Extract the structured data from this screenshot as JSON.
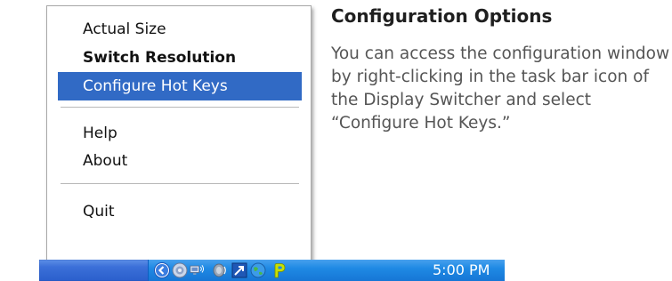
{
  "context_menu": {
    "items": [
      {
        "label": "Actual Size"
      },
      {
        "label": "Switch Resolution"
      },
      {
        "label": "Configure Hot Keys"
      },
      {
        "label": "Help"
      },
      {
        "label": "About"
      },
      {
        "label": "Quit"
      }
    ],
    "selected_index": 2
  },
  "info": {
    "title": "Configuration Options",
    "body": "You can access the configuration window by right-clicking in the task bar icon of the Display Switcher and select “Configure Hot Keys.”"
  },
  "taskbar": {
    "clock": "5:00 PM",
    "tray_icons": [
      "chevron-left-icon",
      "display-switcher-icon",
      "network-icon",
      "volume-icon",
      "app-icon",
      "globe-icon",
      "p-logo-icon"
    ]
  },
  "colors": {
    "selection": "#316ac5",
    "taskbar": "#3b6fd8",
    "tray": "#1f8ae4"
  }
}
